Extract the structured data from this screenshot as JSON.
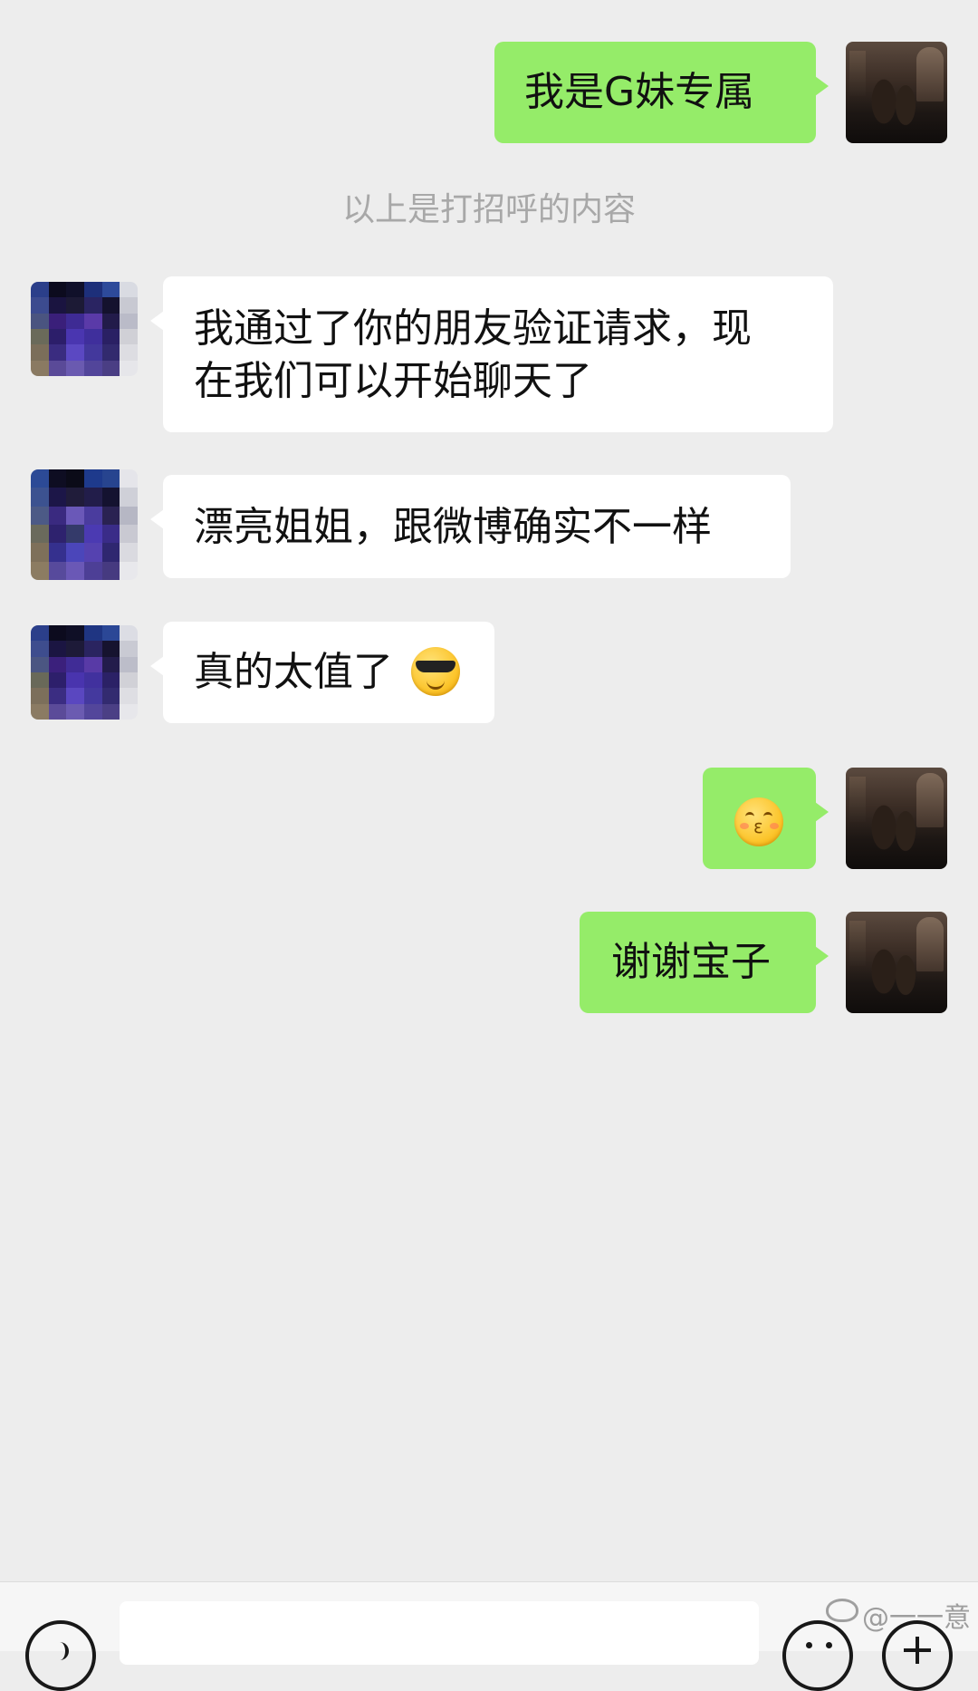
{
  "system_note": "以上是打招呼的内容",
  "messages": [
    {
      "from": "me",
      "text": "我是G妹专属"
    },
    {
      "from": "peer",
      "text": "我通过了你的朋友验证请求，现\n在我们可以开始聊天了"
    },
    {
      "from": "peer",
      "text": "漂亮姐姐，跟微博确实不一样"
    },
    {
      "from": "peer",
      "text": "真的太值了",
      "emoji": "smiling-face-with-sunglasses"
    },
    {
      "from": "me",
      "text": "",
      "emoji": "kissing-face-with-smiling-eyes"
    },
    {
      "from": "me",
      "text": "谢谢宝子"
    }
  ],
  "input_bar": {
    "message_value": "",
    "voice_icon": "voice-icon",
    "emoji_icon": "emoji-icon",
    "plus_icon": "plus-icon"
  },
  "watermark": "@一一意",
  "colors": {
    "background": "#ededed",
    "my_bubble": "#95ec69",
    "peer_bubble": "#ffffff",
    "system_text": "#a8a8a8"
  }
}
